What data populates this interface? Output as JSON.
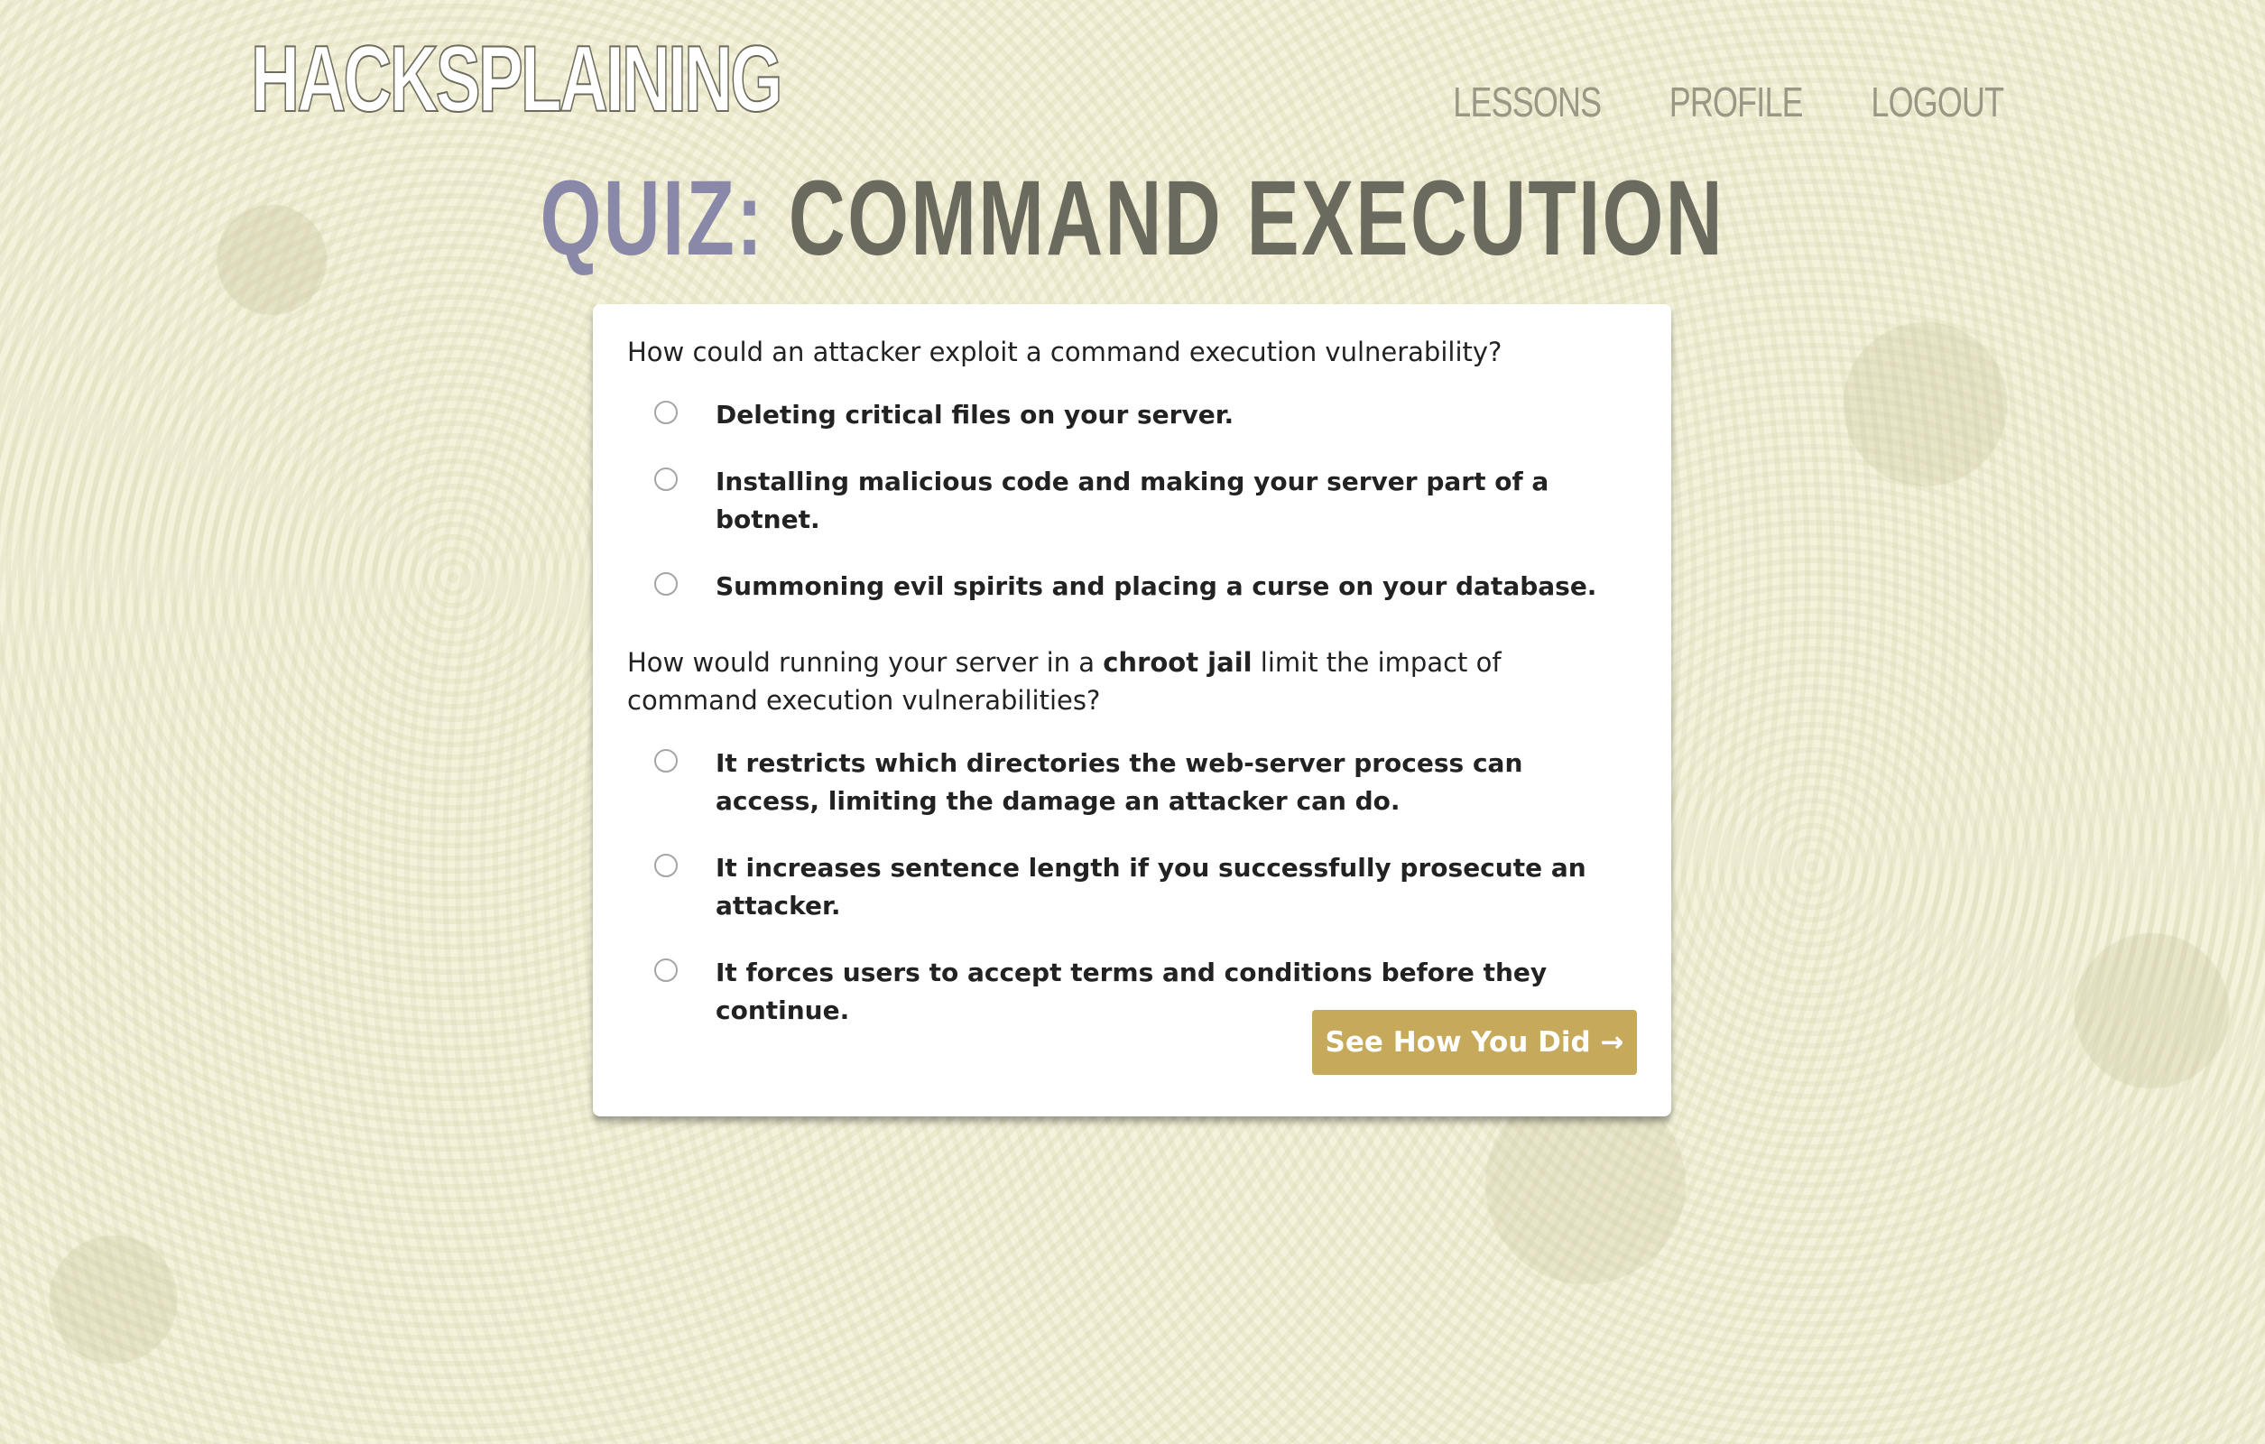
{
  "header": {
    "logo": "HACKSPLAINING",
    "nav": [
      "LESSONS",
      "PROFILE",
      "LOGOUT"
    ]
  },
  "title": {
    "prefix": "QUIZ:",
    "topic": "COMMAND EXECUTION"
  },
  "quiz": {
    "q1": {
      "text": "How could an attacker exploit a command execution vulnerability?",
      "options": [
        "Deleting critical files on your server.",
        "Installing malicious code and making your server part of a botnet.",
        "Summoning evil spirits and placing a curse on your database."
      ]
    },
    "q2": {
      "text_before": "How would running your server in a ",
      "text_bold": "chroot jail",
      "text_after": " limit the impact of command execution vulnerabilities?",
      "options": [
        "It restricts which directories the web-server process can access, limiting the damage an attacker can do.",
        "It increases sentence length if you successfully prosecute an attacker.",
        "It forces users to accept terms and conditions before they continue."
      ]
    },
    "submit_label": "See How You Did →"
  }
}
